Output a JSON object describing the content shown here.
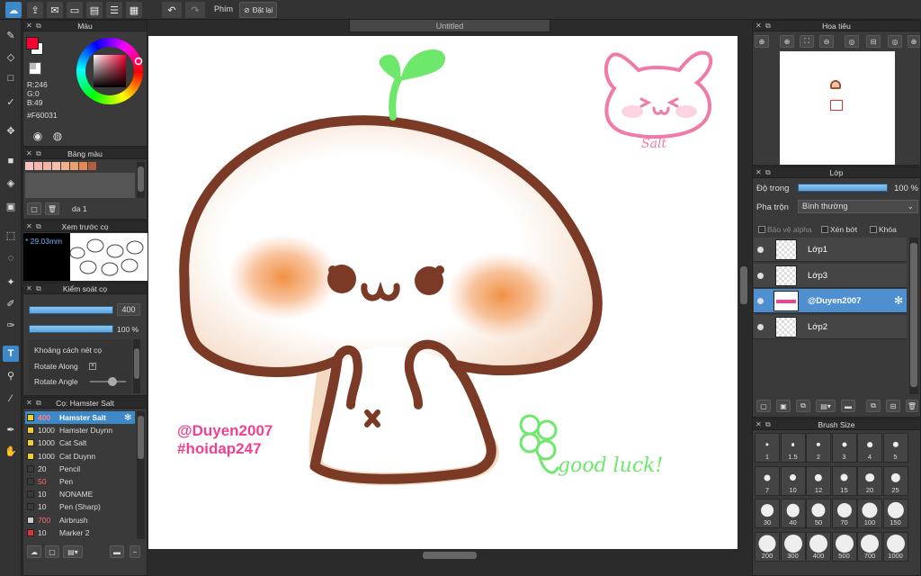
{
  "toolbar": {
    "phim_label": "Phím",
    "dat_lai_label": "Đặt lại"
  },
  "document": {
    "tab_title": "Untitled"
  },
  "color_panel": {
    "title": "Màu",
    "r": "R:246",
    "g": "G:0",
    "b": "B:49",
    "hex": "#F60031",
    "primary_color": "#f60031",
    "secondary_color": "#ffffff"
  },
  "palette_panel": {
    "title": "Bảng màu",
    "swatches": [
      "#f8c0c0",
      "#f5b8b0",
      "#f2b4a4",
      "#f4c0a8",
      "#f2b090",
      "#e8a070",
      "#e08a5a",
      "#b06040"
    ],
    "set_name": "da 1"
  },
  "preview_panel": {
    "title": "Xem trước cọ",
    "size": "29.03mm"
  },
  "brush_control": {
    "title": "Kiểm soát cọ",
    "size_value": "400",
    "opacity_value": "100 %",
    "options": [
      "Khoảng cách nét cọ",
      "Rotate Along",
      "Rotate Angle"
    ]
  },
  "brush_list": {
    "title": "Cọ: Hamster Salt",
    "items": [
      {
        "size": "400",
        "name": "Hamster Salt",
        "color": "#f2d02a"
      },
      {
        "size": "1000",
        "name": "Hamster Duynn",
        "color": "#f2d02a"
      },
      {
        "size": "1000",
        "name": "Cat Salt",
        "color": "#f2d02a"
      },
      {
        "size": "1000",
        "name": "Cat Duynn",
        "color": "#f2d02a"
      },
      {
        "size": "20",
        "name": "Pencil",
        "color": "#3a3a3a"
      },
      {
        "size": "50",
        "name": "Pen",
        "color": "#3a3a3a"
      },
      {
        "size": "10",
        "name": "NONAME",
        "color": "#3a3a3a"
      },
      {
        "size": "10",
        "name": "Pen (Sharp)",
        "color": "#3a3a3a"
      },
      {
        "size": "700",
        "name": "Airbrush",
        "color": "#cccccc"
      },
      {
        "size": "10",
        "name": "Marker 2",
        "color": "#e03030"
      }
    ]
  },
  "navigator": {
    "title": "Hoa tiêu"
  },
  "layer_panel": {
    "title": "Lớp",
    "opacity_label": "Độ trong",
    "opacity_value": "100 %",
    "blend_label": "Pha trộn",
    "blend_value": "Bình thường",
    "protect_alpha": "Bảo vệ alpha",
    "clipping": "Xén bớt",
    "lock": "Khóa",
    "layers": [
      {
        "name": "Lớp1",
        "selected": false
      },
      {
        "name": "Lớp3",
        "selected": false
      },
      {
        "name": "@Duyen2007",
        "selected": true
      },
      {
        "name": "Lớp2",
        "selected": false
      }
    ]
  },
  "brush_size_panel": {
    "title": "Brush Size",
    "sizes": [
      "1",
      "1.5",
      "2",
      "3",
      "4",
      "5",
      "7",
      "10",
      "12",
      "15",
      "20",
      "25",
      "30",
      "40",
      "50",
      "70",
      "100",
      "150",
      "200",
      "300",
      "400",
      "500",
      "700",
      "1000"
    ]
  },
  "artwork": {
    "watermark_line1": "@Duyen2007",
    "watermark_line2": "#hoidap247",
    "good_luck": "good luck!",
    "signature": "Salt"
  }
}
